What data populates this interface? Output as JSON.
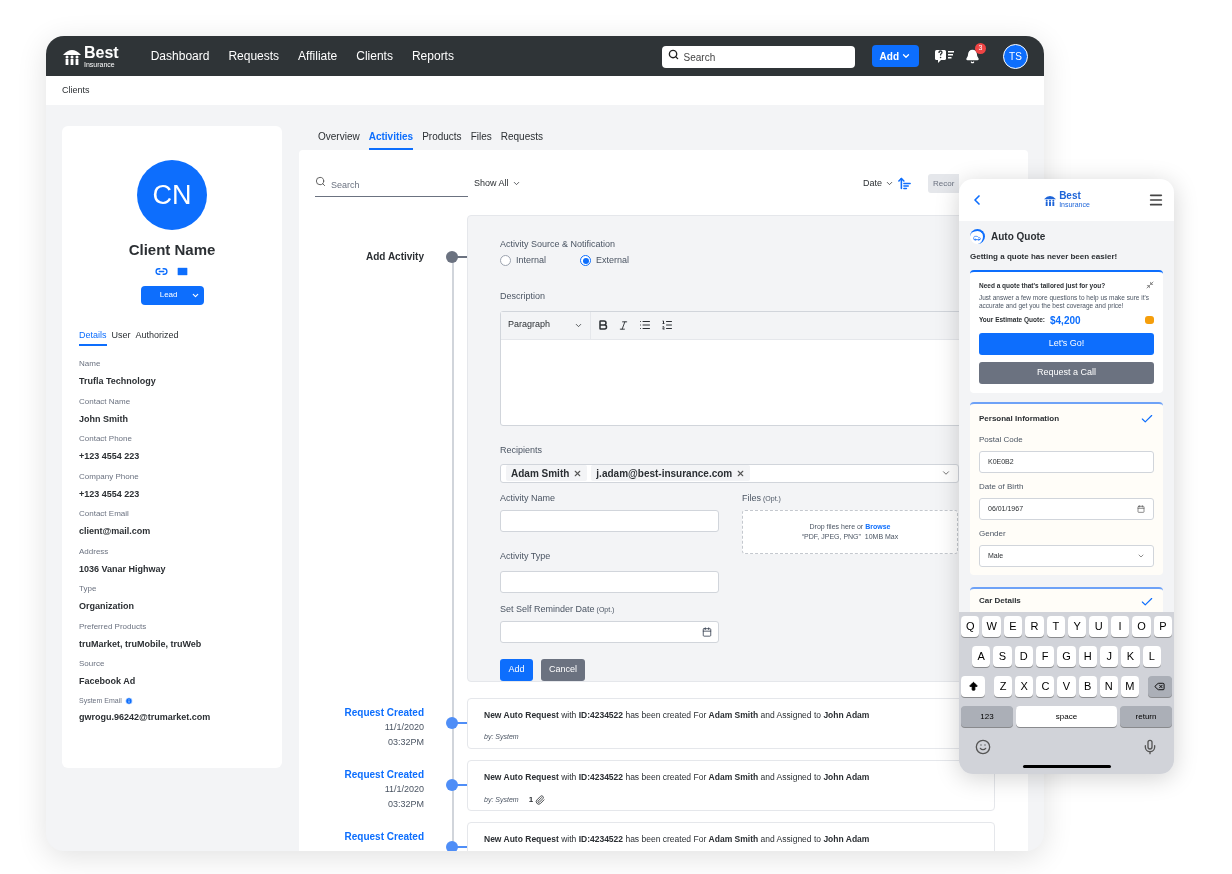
{
  "nav": {
    "logo": {
      "name": "Best",
      "sub": "Insurance"
    },
    "links": [
      "Dashboard",
      "Requests",
      "Affiliate",
      "Clients",
      "Reports"
    ],
    "search": {
      "placeholder": "Search"
    },
    "add_button": "Add",
    "notification_count": "3",
    "avatar": "TS"
  },
  "breadcrumb": "Clients",
  "client": {
    "initials": "CN",
    "name": "Client Name",
    "status": "Lead",
    "tabs": [
      {
        "label": "Details",
        "selected": true
      },
      {
        "label": "User",
        "selected": false
      },
      {
        "label": "Authorized",
        "selected": false
      }
    ],
    "fields": [
      {
        "kind": "plain",
        "label": "Name",
        "value": "Trufla Technology"
      },
      {
        "kind": "plain",
        "label": "Contact Name",
        "value": "John Smith"
      },
      {
        "kind": "plain",
        "label": "Contact Phone",
        "value": "+123 4554 223"
      },
      {
        "kind": "plain",
        "label": "Company Phone",
        "value": "+123 4554 223"
      },
      {
        "kind": "plain",
        "label": "Contact Email",
        "value": "client@mail.com"
      },
      {
        "kind": "plain",
        "label": "Address",
        "value": "1036 Vanar Highway"
      },
      {
        "kind": "plain",
        "label": "Type",
        "value": "Organization"
      },
      {
        "kind": "plain",
        "label": "Preferred Products",
        "value": "truMarket, truMobile, truWeb"
      },
      {
        "kind": "plain",
        "label": "Source",
        "value": "Facebook Ad"
      },
      {
        "kind": "info",
        "label": "System Email",
        "value": "gwrogu.96242@trumarket.com"
      }
    ]
  },
  "tabs": [
    {
      "label": "Overview",
      "selected": false
    },
    {
      "label": "Activities",
      "selected": true
    },
    {
      "label": "Products",
      "selected": false
    },
    {
      "label": "Files",
      "selected": false
    },
    {
      "label": "Requests",
      "selected": false
    }
  ],
  "toolbar": {
    "search": {
      "placeholder": "Search"
    },
    "filter": "Show All",
    "sort": "Date",
    "record_button": "Recor"
  },
  "add_activity": {
    "heading": "Add Activity",
    "source_label": "Activity Source & Notification",
    "sources": [
      {
        "label": "Internal",
        "selected": false
      },
      {
        "label": "External",
        "selected": true
      }
    ],
    "description_label": "Description",
    "paragraph_style": "Paragraph",
    "recipients_label": "Recipients",
    "recipients": [
      "Adam Smith",
      "j.adam@best-insurance.com"
    ],
    "activity_name_label": "Activity Name",
    "activity_type_label": "Activity Type",
    "reminder_label": "Set Self Reminder Date",
    "reminder_opt": "(Opt.)",
    "files_label": "Files",
    "files_opt": "(Opt.)",
    "drop_text": "Drop files here or",
    "browse_link": "Browse",
    "drop_formats": "“PDF, JPEG, PNG”  10MB Max",
    "add_button": "Add",
    "cancel_button": "Cancel"
  },
  "timeline": [
    {
      "title": "Request Created",
      "date": "11/1/2020",
      "time": "03:32PM",
      "message": "**New Auto Request** with **ID:4234522** has been created For **Adam Smith** and Assigned to **John Adam**",
      "by": "by: System"
    },
    {
      "title": "Request Created",
      "date": "11/1/2020",
      "time": "03:32PM",
      "message": "**New Auto Request** with **ID:4234522** has been created For **Adam Smith** and Assigned to **John Adam**",
      "by": "by: System",
      "attachments": "1"
    },
    {
      "title": "Request Created",
      "message": "**New Auto Request** with **ID:4234522** has been created For **Adam Smith** and Assigned to **John Adam**"
    }
  ],
  "phone": {
    "logo": {
      "name": "Best",
      "sub": "Insurance"
    },
    "title": "Auto Quote",
    "subtitle": "Getting a quote has never been easier!",
    "promo": {
      "title": "Need a quote that's tailored just for you?",
      "body": "Just answer a few more questions to help us make sure it's accurate and get you the best coverage and price!",
      "estimate_label": "Your Estimate Quote:",
      "estimate": "$4,200",
      "primary_button": "Let's Go!",
      "secondary_button": "Request a Call"
    },
    "personal": {
      "title": "Personal Information",
      "completed": true,
      "fields": [
        {
          "kind": "text",
          "label": "Postal Code",
          "value": "K0E0B2"
        },
        {
          "kind": "date",
          "label": "Date of Birth",
          "value": "06/01/1967"
        },
        {
          "kind": "select",
          "label": "Gender",
          "value": "Male"
        }
      ]
    },
    "car": {
      "title": "Car Details",
      "completed": true
    },
    "keyboard": {
      "rows": [
        [
          "Q",
          "W",
          "E",
          "R",
          "T",
          "Y",
          "U",
          "I",
          "O",
          "P"
        ],
        [
          "A",
          "S",
          "D",
          "F",
          "G",
          "H",
          "J",
          "K",
          "L"
        ],
        [
          "Z",
          "X",
          "C",
          "V",
          "B",
          "N",
          "M"
        ]
      ],
      "numbers_key": "123",
      "space_key": "space",
      "return_key": "return"
    }
  }
}
